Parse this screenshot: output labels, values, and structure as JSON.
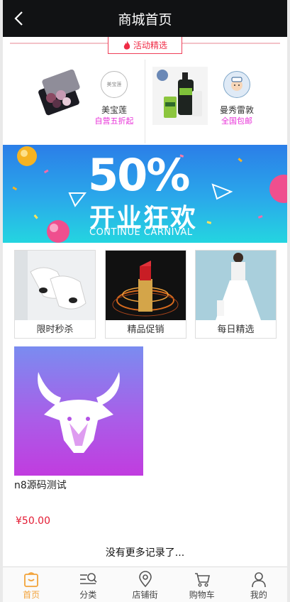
{
  "header": {
    "title": "商城首页"
  },
  "activity": {
    "label": "活动精选"
  },
  "promos": [
    {
      "name": "美宝莲",
      "subtitle": "自营五折起",
      "logo_text": "美宝莲"
    },
    {
      "name": "曼秀雷敦",
      "subtitle": "全国包邮"
    }
  ],
  "banner": {
    "headline": "50%",
    "title_cn": "开业狂欢",
    "title_en": "CONTINUE CARNIVAL"
  },
  "categories": [
    {
      "label": "限时秒杀"
    },
    {
      "label": "精品促销"
    },
    {
      "label": "每日精选"
    }
  ],
  "product": {
    "name": "n8源码测试",
    "price": "¥50.00"
  },
  "list_end": "没有更多记录了...",
  "tabbar": [
    {
      "label": "首页",
      "icon": "home-icon",
      "active": true
    },
    {
      "label": "分类",
      "icon": "category-icon"
    },
    {
      "label": "店铺街",
      "icon": "location-pin-icon"
    },
    {
      "label": "购物车",
      "icon": "cart-icon"
    },
    {
      "label": "我的",
      "icon": "user-icon"
    }
  ],
  "colors": {
    "header_bg": "#111214",
    "accent": "#f2a33a",
    "price": "#e31b33",
    "tag": "#ef2b45",
    "promo_sub": "#e831d8"
  }
}
